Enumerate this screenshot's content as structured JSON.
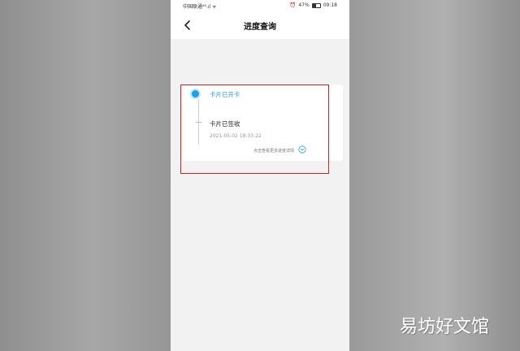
{
  "status_bar": {
    "carrier": "中国联通",
    "signal": "⁴⁶.ıl",
    "wifi": "ᯤ",
    "alarm": "⏰",
    "battery_percent": "47%",
    "time": "09:18"
  },
  "header": {
    "title": "进度查询",
    "back_icon": "chevron-left-icon"
  },
  "progress": {
    "current_step": "卡片已开卡",
    "steps": [
      {
        "title": "卡片已签收",
        "time": "2021-05-02 18:33:22"
      }
    ],
    "more_link": "点击查看更多进度详情",
    "expand_icon": "chevron-down-circle-icon"
  },
  "watermark": "易坊好文馆",
  "colors": {
    "accent": "#1aa1e6",
    "highlight_border": "#c8242c",
    "background": "#f2f2f2"
  }
}
